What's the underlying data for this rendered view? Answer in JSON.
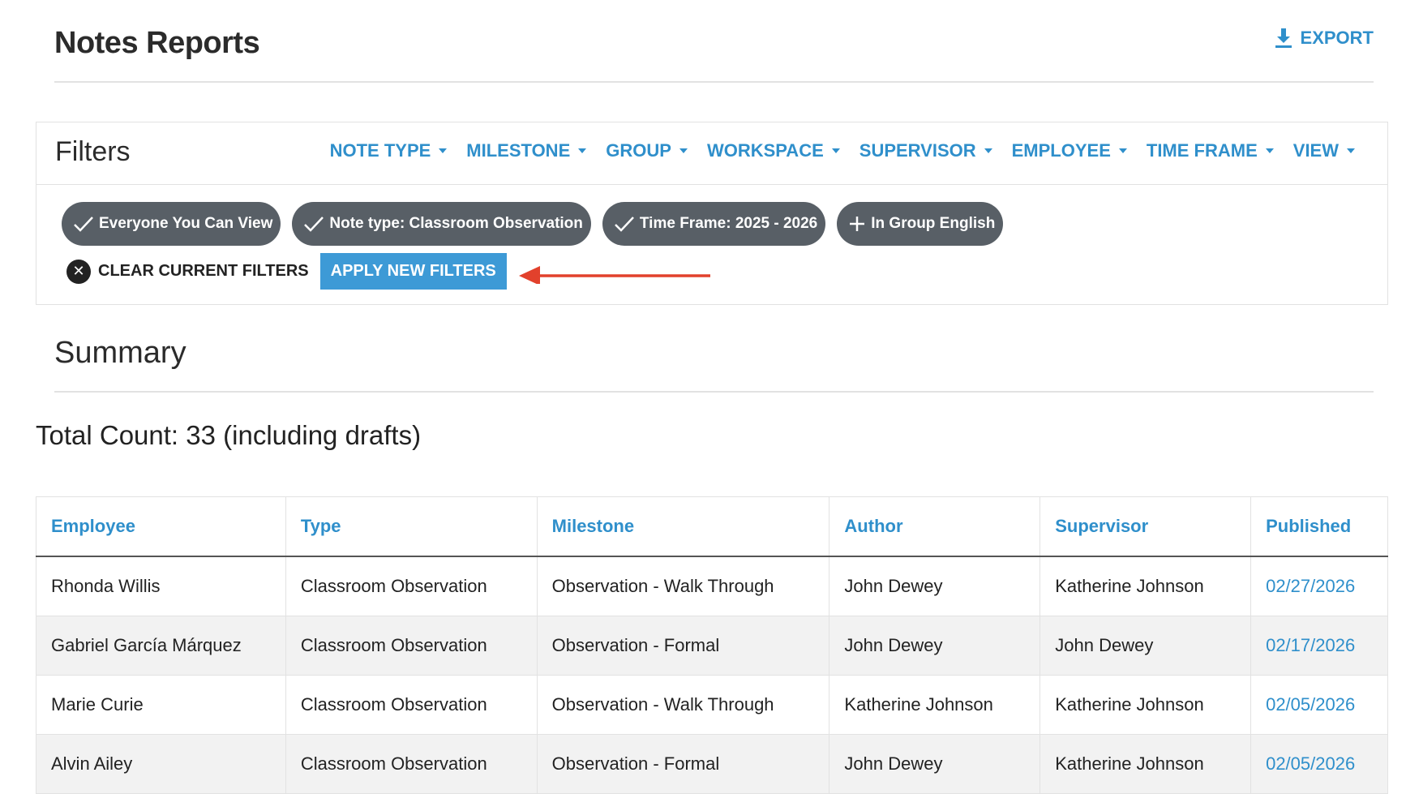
{
  "header": {
    "title": "Notes Reports",
    "export_label": "EXPORT"
  },
  "filters": {
    "title": "Filters",
    "menu": [
      "NOTE TYPE",
      "MILESTONE",
      "GROUP",
      "WORKSPACE",
      "SUPERVISOR",
      "EMPLOYEE",
      "TIME FRAME",
      "VIEW"
    ],
    "chips": [
      {
        "label": "Everyone You Can View",
        "icon": "check-icon"
      },
      {
        "label": "Note type: Classroom Observation",
        "icon": "check-icon"
      },
      {
        "label": "Time Frame: 2025 - 2026",
        "icon": "check-icon"
      },
      {
        "label": "In Group English",
        "icon": "plus-icon"
      }
    ],
    "clear_label": "CLEAR CURRENT FILTERS",
    "apply_label": "APPLY NEW FILTERS"
  },
  "summary": {
    "title": "Summary",
    "total": "Total Count: 33 (including drafts)"
  },
  "table": {
    "columns": [
      "Employee",
      "Type",
      "Milestone",
      "Author",
      "Supervisor",
      "Published"
    ],
    "rows": [
      [
        "Rhonda Willis",
        "Classroom Observation",
        "Observation - Walk Through",
        "John Dewey",
        "Katherine Johnson",
        "02/27/2026"
      ],
      [
        "Gabriel García Márquez",
        "Classroom Observation",
        "Observation - Formal",
        "John Dewey",
        "John Dewey",
        "02/17/2026"
      ],
      [
        "Marie Curie",
        "Classroom Observation",
        "Observation - Walk Through",
        "Katherine Johnson",
        "Katherine Johnson",
        "02/05/2026"
      ],
      [
        "Alvin Ailey",
        "Classroom Observation",
        "Observation - Formal",
        "John Dewey",
        "Katherine Johnson",
        "02/05/2026"
      ]
    ]
  },
  "colors": {
    "accent": "#2f8fcb",
    "chip": "#585f66",
    "apply": "#3d9ad6",
    "arrow": "#e2412c"
  }
}
